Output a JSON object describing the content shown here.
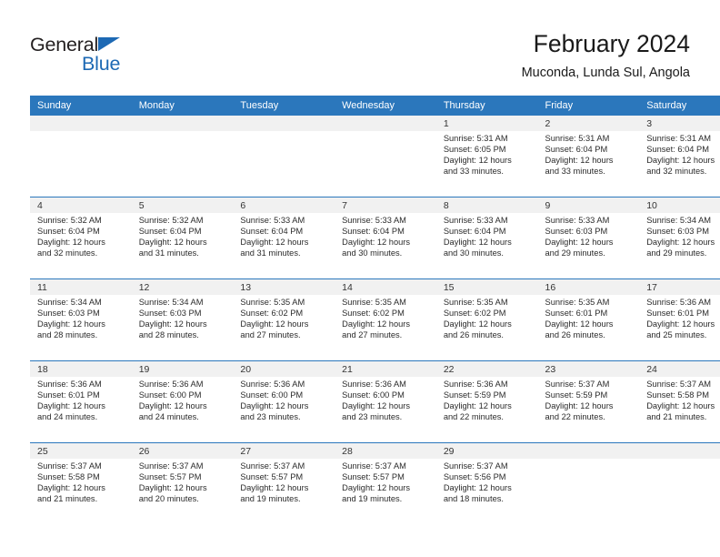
{
  "brand": {
    "name_part1": "General",
    "name_part2": "Blue",
    "flag_icon": "triangle-flag-icon",
    "accent_color": "#1d69b4"
  },
  "header": {
    "title": "February 2024",
    "subtitle": "Muconda, Lunda Sul, Angola"
  },
  "colors": {
    "header_row_bg": "#2b77bc",
    "daynum_band_bg": "#f1f1f1",
    "row_separator": "#2b77bc",
    "text": "#2b2b2b",
    "page_bg": "#ffffff"
  },
  "weekday_headers": [
    "Sunday",
    "Monday",
    "Tuesday",
    "Wednesday",
    "Thursday",
    "Friday",
    "Saturday"
  ],
  "weeks": [
    [
      {
        "day": "",
        "lines": []
      },
      {
        "day": "",
        "lines": []
      },
      {
        "day": "",
        "lines": []
      },
      {
        "day": "",
        "lines": []
      },
      {
        "day": "1",
        "lines": [
          "Sunrise: 5:31 AM",
          "Sunset: 6:05 PM",
          "Daylight: 12 hours",
          "and 33 minutes."
        ]
      },
      {
        "day": "2",
        "lines": [
          "Sunrise: 5:31 AM",
          "Sunset: 6:04 PM",
          "Daylight: 12 hours",
          "and 33 minutes."
        ]
      },
      {
        "day": "3",
        "lines": [
          "Sunrise: 5:31 AM",
          "Sunset: 6:04 PM",
          "Daylight: 12 hours",
          "and 32 minutes."
        ]
      }
    ],
    [
      {
        "day": "4",
        "lines": [
          "Sunrise: 5:32 AM",
          "Sunset: 6:04 PM",
          "Daylight: 12 hours",
          "and 32 minutes."
        ]
      },
      {
        "day": "5",
        "lines": [
          "Sunrise: 5:32 AM",
          "Sunset: 6:04 PM",
          "Daylight: 12 hours",
          "and 31 minutes."
        ]
      },
      {
        "day": "6",
        "lines": [
          "Sunrise: 5:33 AM",
          "Sunset: 6:04 PM",
          "Daylight: 12 hours",
          "and 31 minutes."
        ]
      },
      {
        "day": "7",
        "lines": [
          "Sunrise: 5:33 AM",
          "Sunset: 6:04 PM",
          "Daylight: 12 hours",
          "and 30 minutes."
        ]
      },
      {
        "day": "8",
        "lines": [
          "Sunrise: 5:33 AM",
          "Sunset: 6:04 PM",
          "Daylight: 12 hours",
          "and 30 minutes."
        ]
      },
      {
        "day": "9",
        "lines": [
          "Sunrise: 5:33 AM",
          "Sunset: 6:03 PM",
          "Daylight: 12 hours",
          "and 29 minutes."
        ]
      },
      {
        "day": "10",
        "lines": [
          "Sunrise: 5:34 AM",
          "Sunset: 6:03 PM",
          "Daylight: 12 hours",
          "and 29 minutes."
        ]
      }
    ],
    [
      {
        "day": "11",
        "lines": [
          "Sunrise: 5:34 AM",
          "Sunset: 6:03 PM",
          "Daylight: 12 hours",
          "and 28 minutes."
        ]
      },
      {
        "day": "12",
        "lines": [
          "Sunrise: 5:34 AM",
          "Sunset: 6:03 PM",
          "Daylight: 12 hours",
          "and 28 minutes."
        ]
      },
      {
        "day": "13",
        "lines": [
          "Sunrise: 5:35 AM",
          "Sunset: 6:02 PM",
          "Daylight: 12 hours",
          "and 27 minutes."
        ]
      },
      {
        "day": "14",
        "lines": [
          "Sunrise: 5:35 AM",
          "Sunset: 6:02 PM",
          "Daylight: 12 hours",
          "and 27 minutes."
        ]
      },
      {
        "day": "15",
        "lines": [
          "Sunrise: 5:35 AM",
          "Sunset: 6:02 PM",
          "Daylight: 12 hours",
          "and 26 minutes."
        ]
      },
      {
        "day": "16",
        "lines": [
          "Sunrise: 5:35 AM",
          "Sunset: 6:01 PM",
          "Daylight: 12 hours",
          "and 26 minutes."
        ]
      },
      {
        "day": "17",
        "lines": [
          "Sunrise: 5:36 AM",
          "Sunset: 6:01 PM",
          "Daylight: 12 hours",
          "and 25 minutes."
        ]
      }
    ],
    [
      {
        "day": "18",
        "lines": [
          "Sunrise: 5:36 AM",
          "Sunset: 6:01 PM",
          "Daylight: 12 hours",
          "and 24 minutes."
        ]
      },
      {
        "day": "19",
        "lines": [
          "Sunrise: 5:36 AM",
          "Sunset: 6:00 PM",
          "Daylight: 12 hours",
          "and 24 minutes."
        ]
      },
      {
        "day": "20",
        "lines": [
          "Sunrise: 5:36 AM",
          "Sunset: 6:00 PM",
          "Daylight: 12 hours",
          "and 23 minutes."
        ]
      },
      {
        "day": "21",
        "lines": [
          "Sunrise: 5:36 AM",
          "Sunset: 6:00 PM",
          "Daylight: 12 hours",
          "and 23 minutes."
        ]
      },
      {
        "day": "22",
        "lines": [
          "Sunrise: 5:36 AM",
          "Sunset: 5:59 PM",
          "Daylight: 12 hours",
          "and 22 minutes."
        ]
      },
      {
        "day": "23",
        "lines": [
          "Sunrise: 5:37 AM",
          "Sunset: 5:59 PM",
          "Daylight: 12 hours",
          "and 22 minutes."
        ]
      },
      {
        "day": "24",
        "lines": [
          "Sunrise: 5:37 AM",
          "Sunset: 5:58 PM",
          "Daylight: 12 hours",
          "and 21 minutes."
        ]
      }
    ],
    [
      {
        "day": "25",
        "lines": [
          "Sunrise: 5:37 AM",
          "Sunset: 5:58 PM",
          "Daylight: 12 hours",
          "and 21 minutes."
        ]
      },
      {
        "day": "26",
        "lines": [
          "Sunrise: 5:37 AM",
          "Sunset: 5:57 PM",
          "Daylight: 12 hours",
          "and 20 minutes."
        ]
      },
      {
        "day": "27",
        "lines": [
          "Sunrise: 5:37 AM",
          "Sunset: 5:57 PM",
          "Daylight: 12 hours",
          "and 19 minutes."
        ]
      },
      {
        "day": "28",
        "lines": [
          "Sunrise: 5:37 AM",
          "Sunset: 5:57 PM",
          "Daylight: 12 hours",
          "and 19 minutes."
        ]
      },
      {
        "day": "29",
        "lines": [
          "Sunrise: 5:37 AM",
          "Sunset: 5:56 PM",
          "Daylight: 12 hours",
          "and 18 minutes."
        ]
      },
      {
        "day": "",
        "lines": []
      },
      {
        "day": "",
        "lines": []
      }
    ]
  ]
}
